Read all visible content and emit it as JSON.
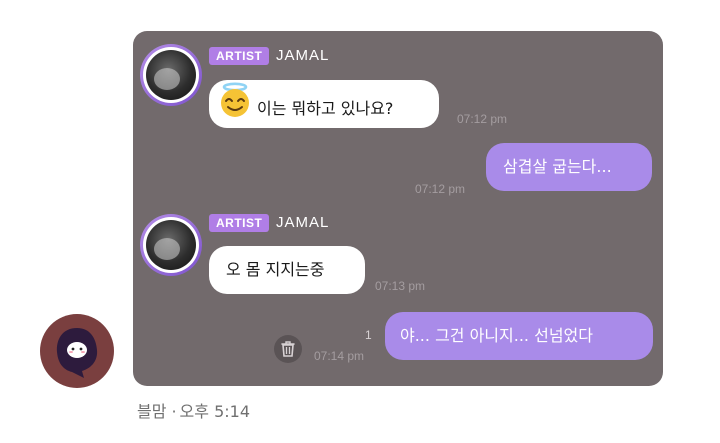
{
  "messages": [
    {
      "sender": "JAMAL",
      "badge": "ARTIST",
      "text": "이는 뭐하고 있나요?",
      "time": "07:12 pm"
    },
    {
      "text": "삼겹살 굽는다...",
      "time": "07:12 pm"
    },
    {
      "sender": "JAMAL",
      "badge": "ARTIST",
      "text": "오 몸 지지는중",
      "time": "07:13 pm"
    },
    {
      "text": "야... 그건 아니지... 선넘었다",
      "time": "07:14 pm",
      "unread": "1"
    }
  ],
  "post": {
    "author": "블맘",
    "separator": "·",
    "time": "오후 5:14"
  },
  "colors": {
    "chat_background": "#726a6c",
    "outgoing_bubble": "#a98be9",
    "badge": "#b07ee6",
    "incoming_bubble": "#ffffff"
  },
  "icons": {
    "emoji": "smiling-face-with-halo",
    "trash": "trash-icon",
    "avatar": "ghost-character"
  }
}
